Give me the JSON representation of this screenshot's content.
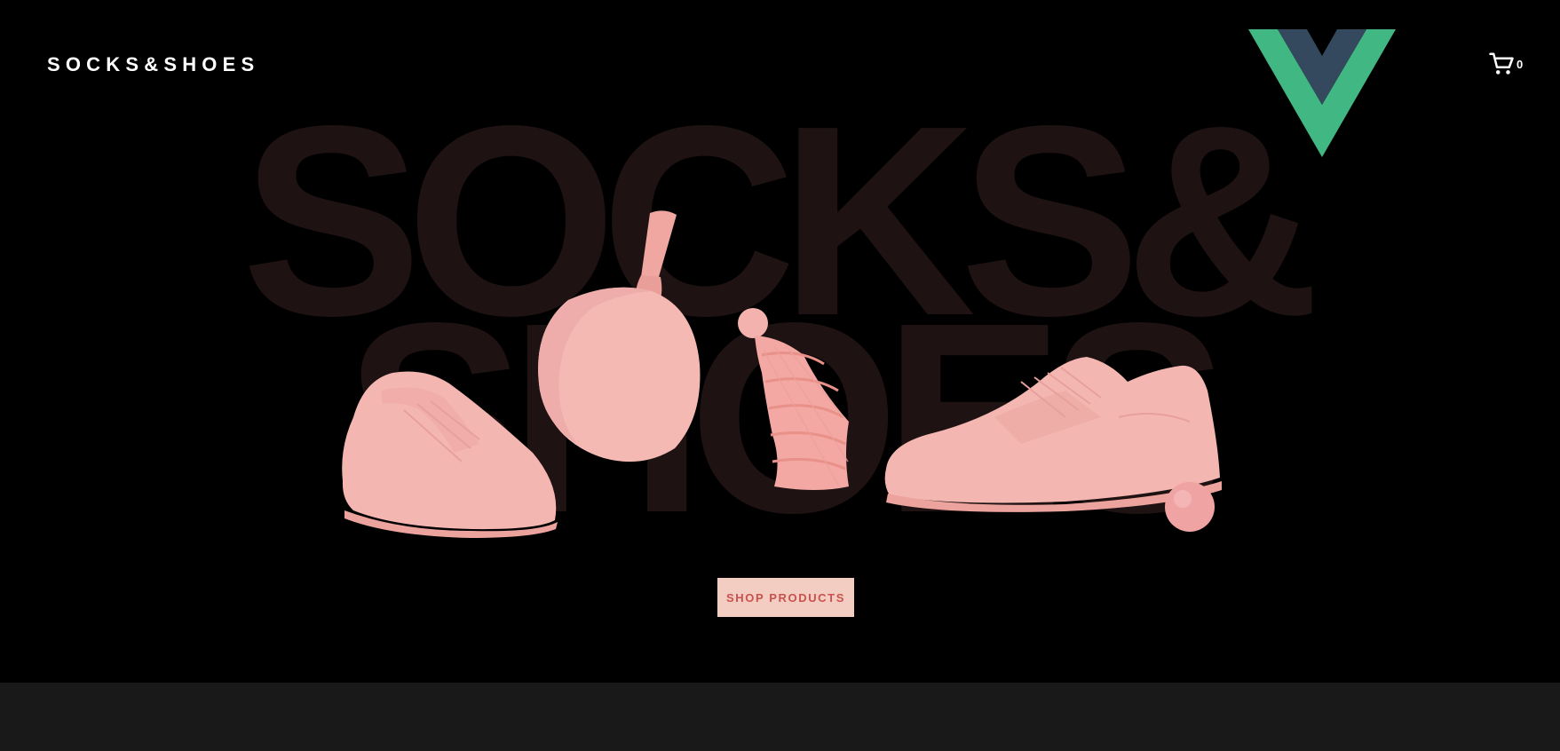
{
  "header": {
    "brand": "SOCKS&SHOES",
    "cart_count": "0"
  },
  "hero": {
    "background_line_1": "SOCKS&",
    "background_line_2": "SHOES",
    "cta_label": "SHOP PRODUCTS"
  },
  "colors": {
    "background": "#000000",
    "background_text": "#1f1212",
    "product_pink": "#f4b4b0",
    "button_bg": "#f3cdc1",
    "button_text": "#c9514f",
    "vue_green": "#41b883",
    "vue_dark": "#34495e",
    "footer_band": "#191919"
  },
  "icons": {
    "cart": "shopping-cart-icon",
    "logo": "vue-logo-icon"
  }
}
